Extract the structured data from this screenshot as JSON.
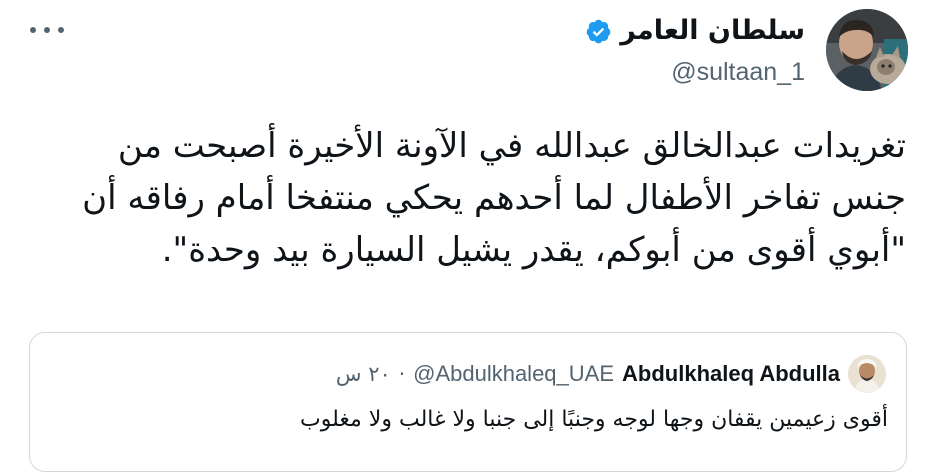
{
  "author": {
    "display_name": "سلطان العامر",
    "handle": "@sultaan_1",
    "verified": true
  },
  "tweet": {
    "text": "تغريدات عبدالخالق عبدالله في الآونة الأخيرة أصبحت من جنس تفاخر الأطفال لما أحدهم يحكي منتفخا أمام رفاقه أن \"أبوي أقوى من أبوكم، يقدر يشيل السيارة بيد وحدة\"."
  },
  "quoted_tweet": {
    "display_name": "Abdulkhaleq Abdulla",
    "handle": "@Abdulkhaleq_UAE",
    "separator": "·",
    "time": "٢٠ س",
    "text": "أقوى زعيمين يقفان وجها لوجه وجنبًا إلى جنبا ولا غالب ولا مغلوب"
  },
  "icons": {
    "verified": "verified-badge-icon",
    "more": "more-options-icon"
  },
  "colors": {
    "verified_blue": "#1d9bf0",
    "text_primary": "#0f1419",
    "text_secondary": "#536471",
    "border": "#cfd9de"
  }
}
